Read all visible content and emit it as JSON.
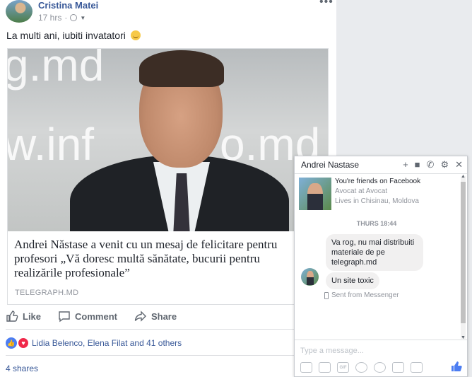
{
  "post": {
    "author": "Cristina Matei",
    "time": "17 hrs",
    "separator": "·",
    "text": "La multi ani, iubiti invatatori",
    "link": {
      "watermark_top": "g.md",
      "watermark_left": "w.inf",
      "watermark_right": "o.md",
      "title": "Andrei Năstase a venit cu un mesaj de felicitare pentru profesori „Vă doresc multă sănătate, bucurii pentru realizările profesionale”",
      "domain": "TELEGRAPH.MD"
    },
    "actions": {
      "like": "Like",
      "comment": "Comment",
      "share": "Share"
    },
    "reactions_text": "Lidia Belenco, Elena Filat and 41 others",
    "shares": "4 shares"
  },
  "chat": {
    "name": "Andrei Nastase",
    "friend_status": "You're friends on Facebook",
    "work": "Avocat at Avocat",
    "location": "Lives in Chisinau, Moldova",
    "timestamp": "THURS 18:44",
    "messages": [
      "Va rog, nu mai distribuiti materiale de pe telegraph.md",
      "Un site toxic"
    ],
    "sent_from": "Sent from Messenger",
    "input_placeholder": "Type a message...",
    "gif_label": "GIF"
  },
  "colors": {
    "link_blue": "#385898",
    "fb_blue": "#4c7df2",
    "love_red": "#f0284a"
  },
  "icons": [
    "globe-icon",
    "more-icon",
    "like-icon",
    "comment-icon",
    "share-icon",
    "plus-icon",
    "video-icon",
    "phone-icon",
    "gear-icon",
    "close-icon",
    "thumbs-up-icon"
  ]
}
